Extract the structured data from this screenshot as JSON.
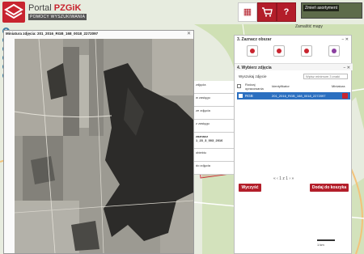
{
  "app": {
    "brand_portal": "Portal ",
    "brand_name": "PZGiK",
    "subtitle": "POMOCY WYSZUKIWANIA"
  },
  "header": {
    "buttons": [
      {
        "name": "layers-button",
        "icon": "layers-icon",
        "glyph": "▦"
      },
      {
        "name": "cart-button",
        "icon": "cart-icon",
        "glyph": "⚗"
      },
      {
        "name": "help-button",
        "icon": "help-icon",
        "glyph": "?"
      }
    ],
    "change_theme": "Zmień asortyment",
    "collapse_map": "Zamaštić mapy"
  },
  "preview": {
    "title": "Miniatura zdjęcia: 201_2016_RGB_168_0018_2272097",
    "close": "✕"
  },
  "mid_list": [
    "zdjęcia",
    "w zasięgu",
    "ze zdjęcia",
    "z zasięgu",
    "zaznacz\n1_23_3_003_2016",
    "obiektu",
    "do zdjęcia"
  ],
  "panel": {
    "section1": {
      "title": "3. Zaznacz obszar",
      "controls": "− ✕"
    },
    "section2": {
      "title": "4. Wybierz zdjęcia",
      "controls": "− ✕"
    },
    "search_label": "Wyszukaj zdjęcie",
    "search_placeholder": "Wpisz minimum 3 znaki",
    "headers": {
      "rodzaj": "Rodzaj opracowania",
      "id": "Identyfikator",
      "mini": "Miniatura"
    },
    "row": {
      "rodzaj": "RGB",
      "id": "201_2016_RGB_168_0018_2272097"
    },
    "pager": "«  ‹  1 z 1  ›  »",
    "btn_clear": "Wyczyść",
    "btn_add": "Dodaj do koszyka"
  },
  "collapse_label": "Zamaštić mapy",
  "scale": "1 km",
  "colors": {
    "accent": "#b31e2a",
    "selection": "#2b6fc0"
  }
}
